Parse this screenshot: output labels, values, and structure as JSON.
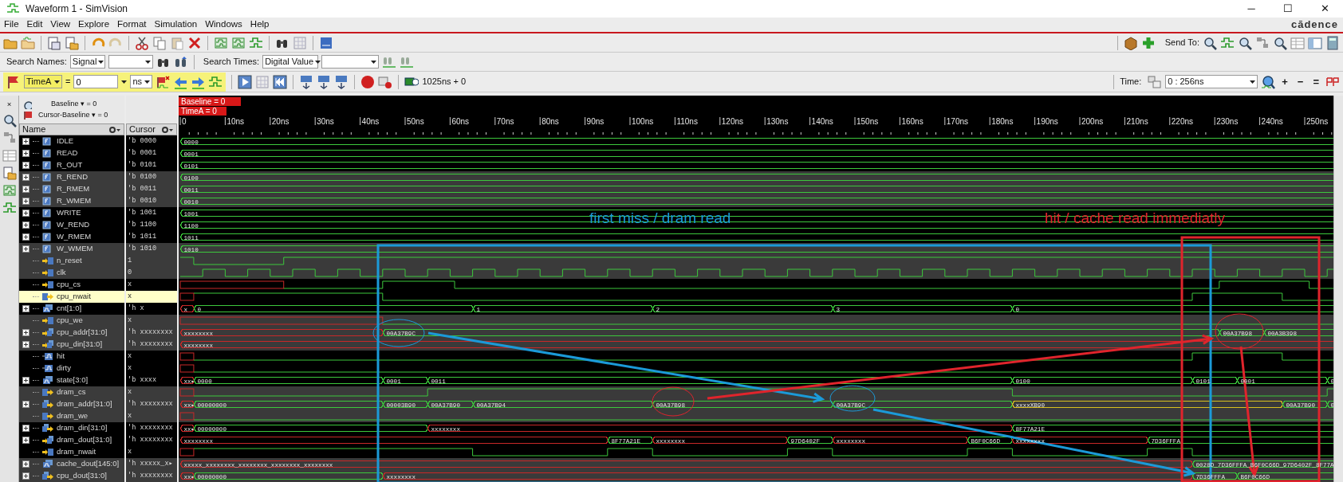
{
  "window": {
    "title": "Waveform 1 - SimVision",
    "controls": [
      "─",
      "☐",
      "✕"
    ]
  },
  "menu": [
    "File",
    "Edit",
    "View",
    "Explore",
    "Format",
    "Simulation",
    "Windows",
    "Help"
  ],
  "brand": "cādence",
  "send_to_label": "Send To:",
  "search_bar": {
    "names_label": "Search Names:",
    "names_scope": "Signal",
    "times_label": "Search Times:",
    "times_scope": "Digital Value"
  },
  "time_bar": {
    "marker": "TimeA",
    "equals": "=",
    "time_value": "0",
    "unit": "ns",
    "sim_time": "1025ns + 0",
    "time_label": "Time:",
    "range": "0 : 256ns",
    "zoom_controls": [
      "+",
      "−",
      "="
    ]
  },
  "panel_controls": [
    "×"
  ],
  "cursor_panel": {
    "baseline": "Baseline ▾ = 0",
    "cursor_baseline": "Cursor-Baseline ▾ = 0"
  },
  "columns": [
    "Name",
    "Cursor"
  ],
  "markers": [
    "Baseline = 0",
    "TimeA = 0"
  ],
  "axis": {
    "ticks": [
      "0",
      "10ns",
      "20ns",
      "30ns",
      "40ns",
      "50ns",
      "60ns",
      "70ns",
      "80ns",
      "90ns",
      "100ns",
      "110ns",
      "120ns",
      "130ns",
      "140ns",
      "150ns",
      "160ns",
      "170ns",
      "180ns",
      "190ns",
      "200ns",
      "210ns",
      "220ns",
      "230ns",
      "240ns",
      "250ns"
    ]
  },
  "signals": [
    {
      "name": "IDLE",
      "cursor": "'b 0000",
      "kind": "param",
      "expandable": true,
      "selected": false,
      "segments": [
        {
          "value": "0000",
          "color": "#3cc83c"
        }
      ]
    },
    {
      "name": "READ",
      "cursor": "'b 0001",
      "kind": "param",
      "expandable": true,
      "selected": false,
      "segments": [
        {
          "value": "0001",
          "color": "#3cc83c"
        }
      ]
    },
    {
      "name": "R_OUT",
      "cursor": "'b 0101",
      "kind": "param",
      "expandable": true,
      "selected": false,
      "segments": [
        {
          "value": "0101",
          "color": "#3cc83c"
        }
      ]
    },
    {
      "name": "R_REND",
      "cursor": "'b 0100",
      "kind": "param",
      "expandable": true,
      "selected": false,
      "segments": [
        {
          "value": "0100",
          "color": "#3cc83c"
        }
      ]
    },
    {
      "name": "R_RMEM",
      "cursor": "'b 0011",
      "kind": "param",
      "expandable": true,
      "selected": false,
      "segments": [
        {
          "value": "0011",
          "color": "#3cc83c"
        }
      ]
    },
    {
      "name": "R_WMEM",
      "cursor": "'b 0010",
      "kind": "param",
      "expandable": true,
      "selected": false,
      "segments": [
        {
          "value": "0010",
          "color": "#3cc83c"
        }
      ]
    },
    {
      "name": "WRITE",
      "cursor": "'b 1001",
      "kind": "param",
      "expandable": true,
      "selected": false,
      "segments": [
        {
          "value": "1001",
          "color": "#3cc83c"
        }
      ]
    },
    {
      "name": "W_REND",
      "cursor": "'b 1100",
      "kind": "param",
      "expandable": true,
      "selected": false,
      "segments": [
        {
          "value": "1100",
          "color": "#3cc83c"
        }
      ]
    },
    {
      "name": "W_RMEM",
      "cursor": "'b 1011",
      "kind": "param",
      "expandable": true,
      "selected": false,
      "segments": [
        {
          "value": "1011",
          "color": "#3cc83c"
        }
      ]
    },
    {
      "name": "W_WMEM",
      "cursor": "'b 1010",
      "kind": "param",
      "expandable": true,
      "selected": false,
      "segments": [
        {
          "value": "1010",
          "color": "#3cc83c"
        }
      ]
    },
    {
      "name": "n_reset",
      "cursor": "1",
      "kind": "in",
      "expandable": false,
      "selected": false
    },
    {
      "name": "clk",
      "cursor": "0",
      "kind": "in",
      "expandable": false,
      "selected": false
    },
    {
      "name": "cpu_cs",
      "cursor": "x",
      "kind": "in",
      "expandable": false,
      "selected": false
    },
    {
      "name": "cpu_nwait",
      "cursor": "x",
      "kind": "out",
      "expandable": false,
      "selected": true
    },
    {
      "name": "cnt[1:0]",
      "cursor": "'h x",
      "kind": "bus_reg",
      "expandable": true,
      "selected": false,
      "segments": [
        {
          "value": "x",
          "color": "#c82828"
        },
        {
          "value": "0",
          "color": "#3cc83c"
        },
        {
          "value": "1",
          "color": "#3cc83c"
        },
        {
          "value": "2",
          "color": "#3cc83c"
        },
        {
          "value": "3",
          "color": "#3cc83c"
        },
        {
          "value": "0",
          "color": "#3cc83c"
        }
      ]
    },
    {
      "name": "cpu_we",
      "cursor": "x",
      "kind": "in",
      "expandable": false,
      "selected": false
    },
    {
      "name": "cpu_addr[31:0]",
      "cursor": "'h xxxxxxxx",
      "kind": "bus_in",
      "expandable": true,
      "selected": false,
      "segments": [
        {
          "value": "xxxxxxxx",
          "color": "#c82828"
        },
        {
          "value": "00A37B9C",
          "color": "#3cc83c"
        },
        {
          "value": "00A37B98",
          "color": "#3cc83c"
        },
        {
          "value": "00A3B398",
          "color": "#3cc83c"
        }
      ]
    },
    {
      "name": "cpu_din[31:0]",
      "cursor": "'h xxxxxxxx",
      "kind": "bus_in",
      "expandable": true,
      "selected": false,
      "segments": [
        {
          "value": "xxxxxxxx",
          "color": "#c82828"
        }
      ]
    },
    {
      "name": "hit",
      "cursor": "x",
      "kind": "wire",
      "expandable": false,
      "selected": false
    },
    {
      "name": "dirty",
      "cursor": "x",
      "kind": "wire",
      "expandable": false,
      "selected": false
    },
    {
      "name": "state[3:0]",
      "cursor": "'b xxxx",
      "kind": "bus_reg",
      "expandable": true,
      "selected": false,
      "segments": [
        {
          "value": "xx▸",
          "color": "#c82828"
        },
        {
          "value": "0000",
          "color": "#3cc83c"
        },
        {
          "value": "0001",
          "color": "#3cc83c"
        },
        {
          "value": "0011",
          "color": "#3cc83c"
        },
        {
          "value": "0100",
          "color": "#3cc83c"
        },
        {
          "value": "0101",
          "color": "#3cc83c"
        },
        {
          "value": "0001",
          "color": "#3cc83c"
        },
        {
          "value": "0",
          "color": "#3cc83c"
        }
      ]
    },
    {
      "name": "dram_cs",
      "cursor": "x",
      "kind": "out",
      "expandable": false,
      "selected": false
    },
    {
      "name": "dram_addr[31:0]",
      "cursor": "'h xxxxxxxx",
      "kind": "bus_out",
      "expandable": true,
      "selected": false,
      "segments": [
        {
          "value": "xx▸",
          "color": "#c82828"
        },
        {
          "value": "00000000",
          "color": "#3cc83c"
        },
        {
          "value": "00003B90",
          "color": "#3cc83c"
        },
        {
          "value": "00A37B90",
          "color": "#3cc83c"
        },
        {
          "value": "00A37B94",
          "color": "#3cc83c"
        },
        {
          "value": "00A37B98",
          "color": "#3cc83c"
        },
        {
          "value": "00A37B9C",
          "color": "#3cc83c"
        },
        {
          "value": "xxxxXB90",
          "color": "#d8c020"
        },
        {
          "value": "00A37B90",
          "color": "#3cc83c"
        },
        {
          "value": "0",
          "color": "#3cc83c"
        }
      ]
    },
    {
      "name": "dram_we",
      "cursor": "x",
      "kind": "out",
      "expandable": false,
      "selected": false
    },
    {
      "name": "dram_din[31:0]",
      "cursor": "'h xxxxxxxx",
      "kind": "bus_out",
      "expandable": true,
      "selected": false,
      "segments": [
        {
          "value": "xx▸",
          "color": "#c82828"
        },
        {
          "value": "00000000",
          "color": "#3cc83c"
        },
        {
          "value": "xxxxxxxx",
          "color": "#c82828"
        },
        {
          "value": "8F77A21E",
          "color": "#3cc83c"
        }
      ]
    },
    {
      "name": "dram_dout[31:0]",
      "cursor": "'h xxxxxxxx",
      "kind": "bus_in",
      "expandable": true,
      "selected": false,
      "segments": [
        {
          "value": "xxxxxxxx",
          "color": "#c82828"
        },
        {
          "value": "8F77A21E",
          "color": "#3cc83c"
        },
        {
          "value": "xxxxxxxx",
          "color": "#c82828"
        },
        {
          "value": "97D6402F",
          "color": "#3cc83c"
        },
        {
          "value": "xxxxxxxx",
          "color": "#c82828"
        },
        {
          "value": "B6F0C66D",
          "color": "#3cc83c"
        },
        {
          "value": "xxxxxxxx",
          "color": "#c82828"
        },
        {
          "value": "7D36FFFA",
          "color": "#3cc83c"
        }
      ]
    },
    {
      "name": "dram_nwait",
      "cursor": "x",
      "kind": "in",
      "expandable": false,
      "selected": false
    },
    {
      "name": "cache_dout[145:0]",
      "cursor": "'h xxxxx_x▸",
      "kind": "bus_reg",
      "expandable": true,
      "selected": false,
      "segments": [
        {
          "value": "xxxxx_xxxxxxxx_xxxxxxxx_xxxxxxxx_xxxxxxxx",
          "color": "#c82828"
        },
        {
          "value": "0028D_7D36FFFA_B6F0C66D_97D6402F_8F77A",
          "color": "#3cc83c"
        }
      ]
    },
    {
      "name": "cpu_dout[31:0]",
      "cursor": "'h xxxxxxxx",
      "kind": "bus_out",
      "expandable": true,
      "selected": false,
      "segments": [
        {
          "value": "xx▸",
          "color": "#c82828"
        },
        {
          "value": "00000000",
          "color": "#3cc83c"
        },
        {
          "value": "xxxxxxxx",
          "color": "#c82828"
        },
        {
          "value": "7D36FFFA",
          "color": "#3cc83c"
        },
        {
          "value": "B6F0C66D",
          "color": "#3cc83c"
        }
      ]
    }
  ],
  "annotations": [
    {
      "text": "first miss / dram read",
      "color": "#1b9ad8"
    },
    {
      "text": "hit / cache read immediatly",
      "color": "#e0242c"
    }
  ]
}
